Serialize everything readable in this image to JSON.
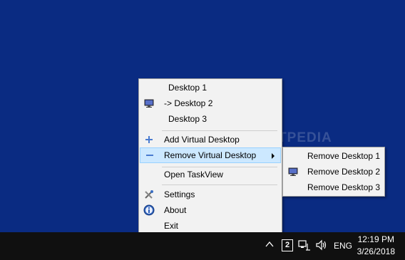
{
  "watermark": "SOFTPEDIA",
  "menu": {
    "desktops": [
      "Desktop 1",
      "-> Desktop 2",
      "Desktop 3"
    ],
    "add": "Add Virtual Desktop",
    "remove": "Remove Virtual Desktop",
    "taskview": "Open TaskView",
    "settings": "Settings",
    "about": "About",
    "exit": "Exit"
  },
  "submenu": {
    "items": [
      "Remove Desktop 1",
      "Remove Desktop 2",
      "Remove Desktop 3"
    ]
  },
  "taskbar": {
    "desktop_number": "2",
    "language": "ENG",
    "time": "12:19 PM",
    "date": "3/26/2018"
  },
  "colors": {
    "desktop": "#0a2b82",
    "menu_bg": "#f2f2f2",
    "highlight": "#cce8ff",
    "taskbar": "#101010"
  }
}
